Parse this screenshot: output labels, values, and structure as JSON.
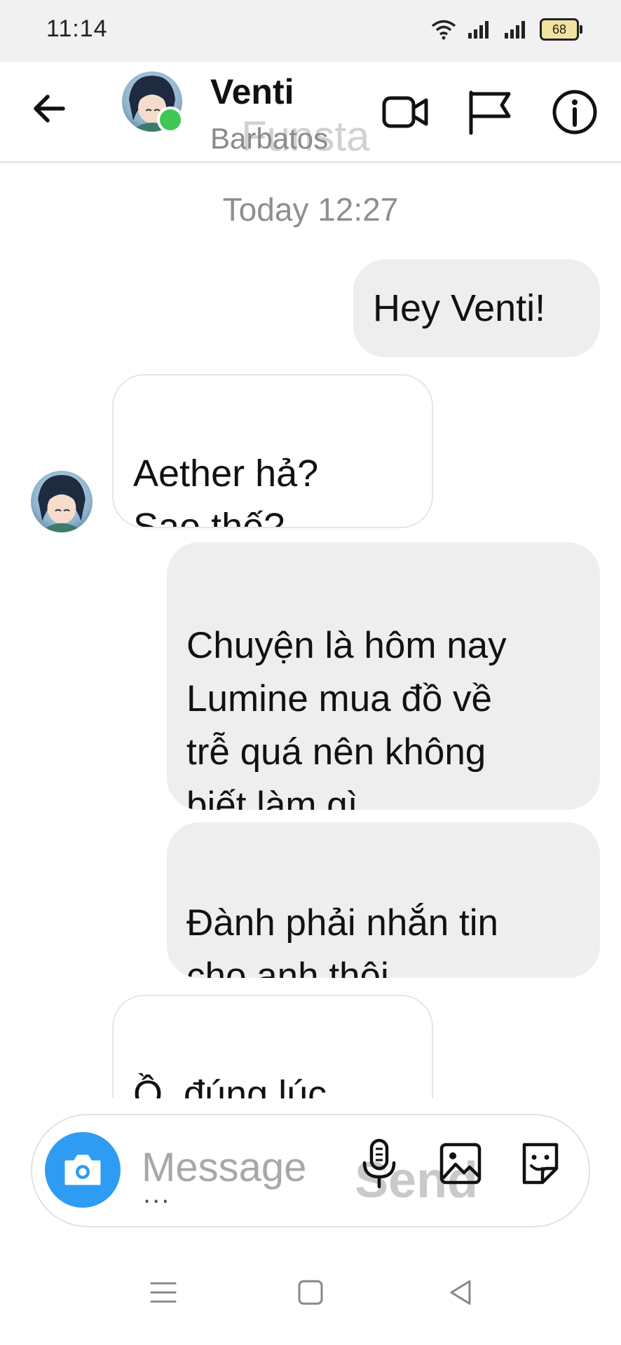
{
  "status_bar": {
    "time": "11:14",
    "battery": "68"
  },
  "header": {
    "contact_name": "Venti",
    "contact_subtitle": "Barbatos",
    "app_watermark": "Funsta"
  },
  "conversation": {
    "timestamp": "Today 12:27",
    "messages": [
      {
        "direction": "out",
        "text": "Hey Venti!"
      },
      {
        "direction": "in",
        "text": "Aether hả?\nSao thế?"
      },
      {
        "direction": "out",
        "text": "Chuyện là hôm nay\nLumine mua đồ về\ntrễ quá nên không\nbiết làm gì"
      },
      {
        "direction": "out",
        "text": "Đành phải nhắn tin\ncho anh thôi"
      },
      {
        "direction": "in",
        "text": "Ồ, đúng lúc\nlắm đó"
      }
    ]
  },
  "composer": {
    "placeholder": "Message",
    "overflow_dots": "...",
    "send_ghost": "Send"
  },
  "icons": {
    "back": "arrow-left-icon",
    "video": "video-camera-icon",
    "report": "flag-icon",
    "info": "info-icon",
    "camera": "camera-icon",
    "mic": "microphone-icon",
    "gallery": "image-icon",
    "sticker": "sticker-icon"
  },
  "colors": {
    "accent": "#2e9cf2",
    "online": "#3fc654",
    "outgoing_bubble": "#eeeeee",
    "incoming_bubble": "#ffffff"
  }
}
